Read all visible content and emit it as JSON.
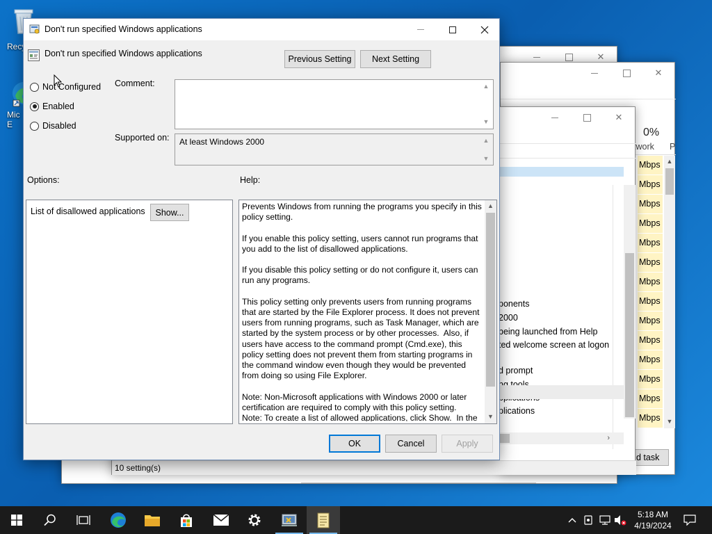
{
  "desktop": {
    "icons": [
      {
        "label": "Recy",
        "icon": "recycle-bin-icon"
      },
      {
        "label": "Mic E",
        "icon": "edge-shortcut-icon"
      }
    ]
  },
  "task_manager": {
    "percent": "0%",
    "column_network": "twork",
    "column_p": "P",
    "mbps_cells": [
      "Mbps",
      "Mbps",
      "Mbps",
      "Mbps",
      "Mbps",
      "Mbps",
      "Mbps",
      "Mbps",
      "Mbps",
      "Mbps",
      "Mbps",
      "Mbps",
      "Mbps",
      "Mbps"
    ],
    "end_task_label": "d task"
  },
  "gpedit_list": {
    "rows": [
      "ponents",
      "2000",
      "being launched from Help",
      "ted welcome screen at logon",
      "d prompt",
      "ng tools",
      "pplications",
      "plications"
    ],
    "status": "10 setting(s)"
  },
  "dialog": {
    "title": "Don't run specified Windows applications",
    "policy_name": "Don't run specified Windows applications",
    "previous_setting": "Previous Setting",
    "next_setting": "Next Setting",
    "radio_not_configured": "Not Configured",
    "radio_enabled": "Enabled",
    "radio_disabled": "Disabled",
    "selected_state": "Enabled",
    "comment_label": "Comment:",
    "comment_value": "",
    "supported_on_label": "Supported on:",
    "supported_on_value": "At least Windows 2000",
    "options_label": "Options:",
    "help_label": "Help:",
    "option_list_label": "List of disallowed applications",
    "show_button": "Show...",
    "help_text": "Prevents Windows from running the programs you specify in this policy setting.\n\nIf you enable this policy setting, users cannot run programs that you add to the list of disallowed applications.\n\nIf you disable this policy setting or do not configure it, users can run any programs.\n\nThis policy setting only prevents users from running programs that are started by the File Explorer process. It does not prevent users from running programs, such as Task Manager, which are started by the system process or by other processes.  Also, if users have access to the command prompt (Cmd.exe), this policy setting does not prevent them from starting programs in the command window even though they would be prevented from doing so using File Explorer.\n\nNote: Non-Microsoft applications with Windows 2000 or later certification are required to comply with this policy setting.\nNote: To create a list of allowed applications, click Show.  In the Show Contents dialog box, in the Value column, type the application",
    "ok": "OK",
    "cancel": "Cancel",
    "apply": "Apply"
  },
  "taskbar": {
    "time": "5:18 AM",
    "date": "4/19/2024",
    "items": [
      "start-icon",
      "search-icon",
      "task-view-icon",
      "edge-icon",
      "file-explorer-icon",
      "store-icon",
      "mail-icon",
      "settings-icon",
      "control-panel-icon",
      "notepad-icon"
    ]
  },
  "colors": {
    "accent": "#0078d7",
    "desktop": "#0a64b4",
    "highlight_cell": "#fff4c4"
  }
}
